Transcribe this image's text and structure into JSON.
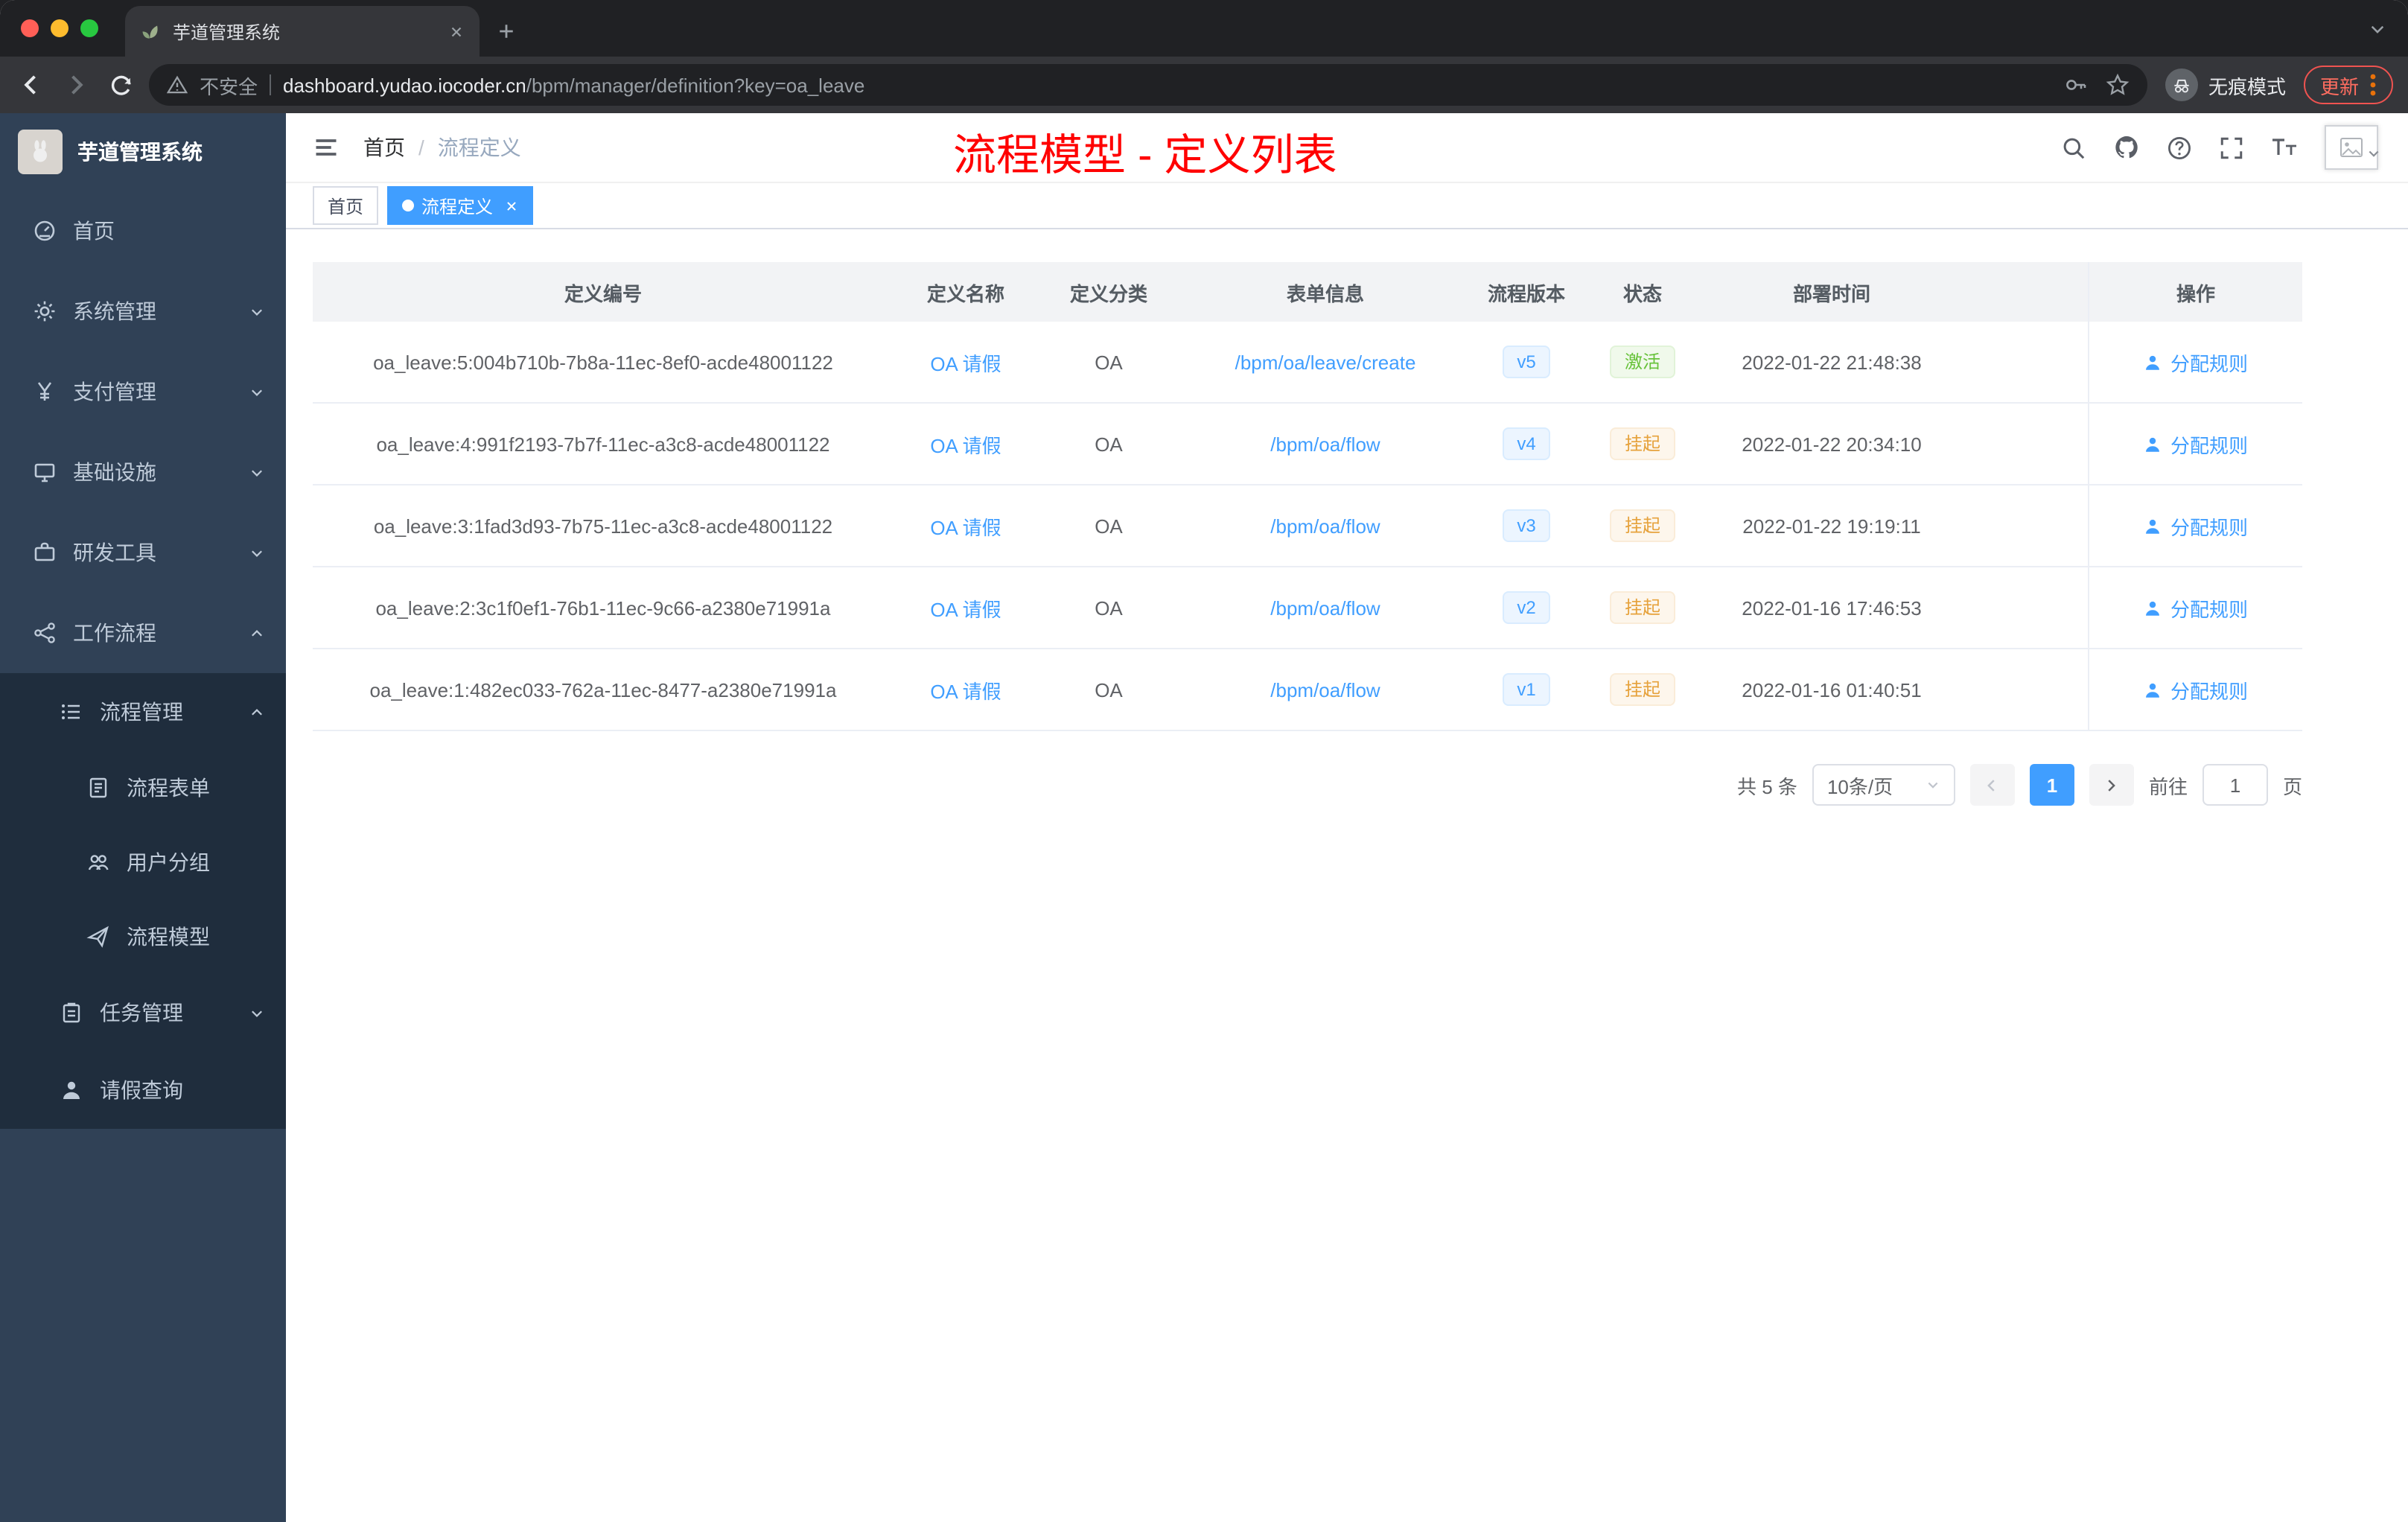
{
  "colors": {
    "accent": "#409eff",
    "success": "#67c23a",
    "warning": "#e6a23c",
    "annotation_red": "#ff0000",
    "sidebar_bg": "#304156",
    "submenu_bg": "#1f2d3d"
  },
  "browser": {
    "tab_title": "芋道管理系统",
    "security_label": "不安全",
    "url_host": "dashboard.yudao.iocoder.cn",
    "url_path": "/bpm/manager/definition?key=oa_leave",
    "incognito_label": "无痕模式",
    "update_label": "更新"
  },
  "sidebar": {
    "logo_title": "芋道管理系统",
    "items": [
      {
        "label": "首页"
      },
      {
        "label": "系统管理"
      },
      {
        "label": "支付管理"
      },
      {
        "label": "基础设施"
      },
      {
        "label": "研发工具"
      },
      {
        "label": "工作流程"
      },
      {
        "label": "流程管理"
      },
      {
        "label": "流程表单"
      },
      {
        "label": "用户分组"
      },
      {
        "label": "流程模型"
      },
      {
        "label": "任务管理"
      },
      {
        "label": "请假查询"
      }
    ]
  },
  "navbar": {
    "breadcrumb_home": "首页",
    "breadcrumb_sep": "/",
    "breadcrumb_current": "流程定义",
    "annotation": "流程模型 - 定义列表"
  },
  "tags": {
    "home": "首页",
    "active": "流程定义"
  },
  "table": {
    "headers": [
      "定义编号",
      "定义名称",
      "定义分类",
      "表单信息",
      "流程版本",
      "状态",
      "部署时间",
      "操作"
    ],
    "rows": [
      {
        "id": "oa_leave:5:004b710b-7b8a-11ec-8ef0-acde48001122",
        "name": "OA 请假",
        "category": "OA",
        "form": "/bpm/oa/leave/create",
        "version": "v5",
        "status": "激活",
        "time": "2022-01-22 21:48:38",
        "action": "分配规则"
      },
      {
        "id": "oa_leave:4:991f2193-7b7f-11ec-a3c8-acde48001122",
        "name": "OA 请假",
        "category": "OA",
        "form": "/bpm/oa/flow",
        "version": "v4",
        "status": "挂起",
        "time": "2022-01-22 20:34:10",
        "action": "分配规则"
      },
      {
        "id": "oa_leave:3:1fad3d93-7b75-11ec-a3c8-acde48001122",
        "name": "OA 请假",
        "category": "OA",
        "form": "/bpm/oa/flow",
        "version": "v3",
        "status": "挂起",
        "time": "2022-01-22 19:19:11",
        "action": "分配规则"
      },
      {
        "id": "oa_leave:2:3c1f0ef1-76b1-11ec-9c66-a2380e71991a",
        "name": "OA 请假",
        "category": "OA",
        "form": "/bpm/oa/flow",
        "version": "v2",
        "status": "挂起",
        "time": "2022-01-16 17:46:53",
        "action": "分配规则"
      },
      {
        "id": "oa_leave:1:482ec033-762a-11ec-8477-a2380e71991a",
        "name": "OA 请假",
        "category": "OA",
        "form": "/bpm/oa/flow",
        "version": "v1",
        "status": "挂起",
        "time": "2022-01-16 01:40:51",
        "action": "分配规则"
      }
    ]
  },
  "pagination": {
    "total": "共 5 条",
    "page_size": "10条/页",
    "page": "1",
    "goto": "前往",
    "goto_value": "1",
    "unit": "页"
  }
}
